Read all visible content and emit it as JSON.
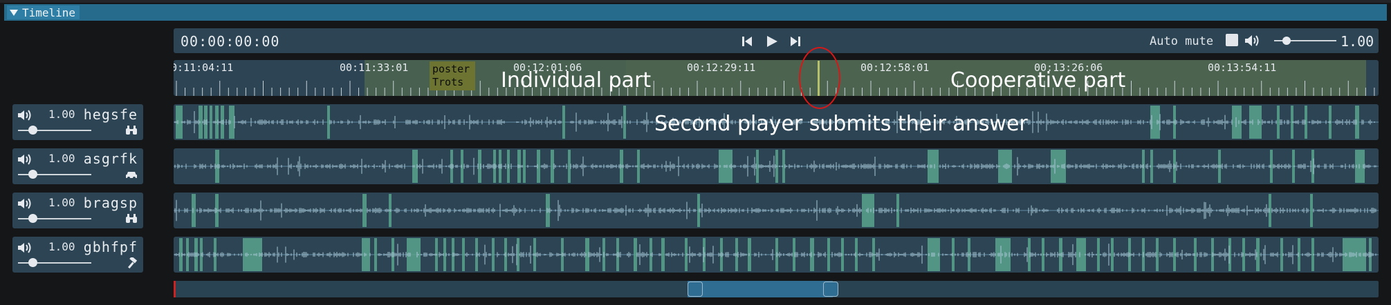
{
  "window": {
    "title": "Timeline"
  },
  "transport": {
    "time": "00:00:00:00",
    "auto_mute_label": "Auto mute",
    "auto_mute_checked": false,
    "volume_value": "1.00",
    "volume_level": 0.2
  },
  "ruler": {
    "tick_labels": [
      "0:11:04:11",
      "00:11:33:01",
      "00:12:01:06",
      "00:12:29:11",
      "00:12:58:01",
      "00:13:26:06",
      "00:13:54:11"
    ],
    "marker_text": "poster\nTrots",
    "segment_colors": {
      "individual": "#47604f",
      "cooperative": "#4c634f"
    }
  },
  "annotations": {
    "individual": "Individual part",
    "cooperative": "Cooperative part",
    "second": "Second player submits their answer"
  },
  "tracks": [
    {
      "name": "hegsfe",
      "volume": "1.00",
      "volume_level": 0.2,
      "icon": "binoculars-icon"
    },
    {
      "name": "asgrfk",
      "volume": "1.00",
      "volume_level": 0.2,
      "icon": "car-icon"
    },
    {
      "name": "bragsp",
      "volume": "1.00",
      "volume_level": 0.2,
      "icon": "binoculars-icon"
    },
    {
      "name": "gbhfpf",
      "volume": "1.00",
      "volume_level": 0.2,
      "icon": "hammer-icon"
    }
  ],
  "colors": {
    "accent": "#266a8c",
    "lane": "#2c4454",
    "clip": "#5aa38d",
    "annotation_ring": "#d61818"
  }
}
